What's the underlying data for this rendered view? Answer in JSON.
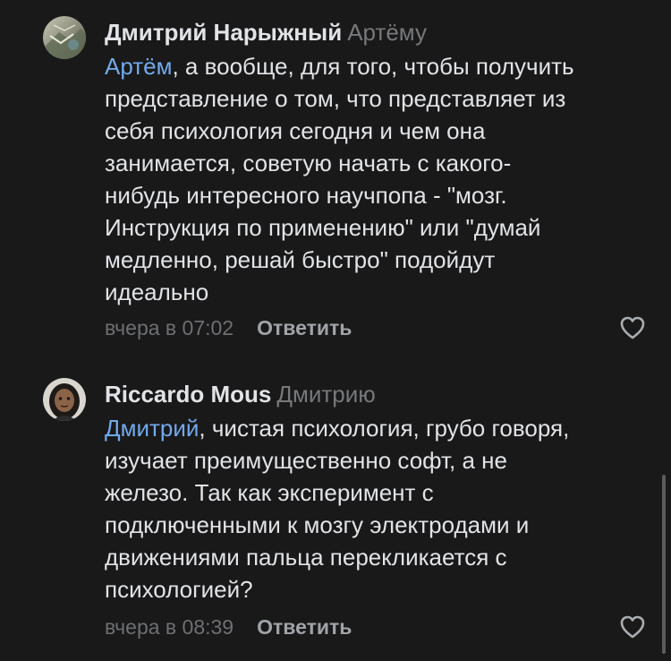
{
  "comments": [
    {
      "author": "Дмитрий Нарыжный",
      "reply_to": "Артёму",
      "mention": "Артём",
      "text_lines": [
        ", а вообще, для того, чтобы получить",
        "представление о том, что представляет из",
        "себя психология сегодня и чем она",
        "занимается, советую начать с какого-",
        "нибудь интересного научпопа - \"мозг.",
        "Инструкция по применению\" или \"думай",
        "медленно, решай быстро\" подойдут",
        "идеально"
      ],
      "time": "вчера в 07:02",
      "reply_label": "Ответить",
      "like_icon": "heart-outline-icon"
    },
    {
      "author": "Riccardo Mous",
      "reply_to": "Дмитрию",
      "mention": "Дмитрий",
      "text_lines": [
        ", чистая психология, грубо говоря,",
        "изучает преимущественно софт, а не",
        "железо. Так как эксперимент с",
        "подключенными к мозгу электродами и",
        "движениями пальца перекликается с",
        "психологией?"
      ],
      "time": "вчера в 08:39",
      "reply_label": "Ответить",
      "like_icon": "heart-outline-icon"
    }
  ],
  "colors": {
    "background": "#19191a",
    "text": "#e1e3e6",
    "mention": "#71aaeb",
    "secondary": "#76787a"
  }
}
